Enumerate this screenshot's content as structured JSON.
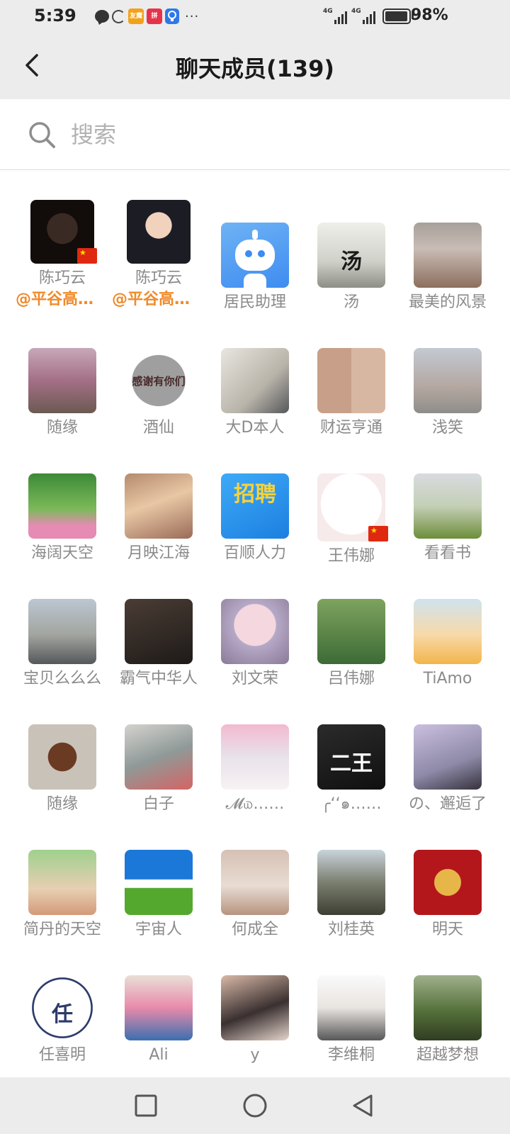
{
  "status_bar": {
    "time": "5:39",
    "app_icon_1": "友魔",
    "app_icon_2": "拼",
    "more": "···",
    "signal_1_label": "4G",
    "signal_2_label": "4G",
    "battery_percent": "98%",
    "battery_level": 0.98
  },
  "header": {
    "title": "聊天成员(139)",
    "back_icon": "chevron-left-icon"
  },
  "search": {
    "placeholder": "搜索",
    "value": ""
  },
  "members": [
    {
      "name": "陈巧云",
      "sub": "@平谷高中附近居民与师生"
    },
    {
      "name": "陈巧云",
      "sub": "@平谷高中附近居民与师生"
    },
    {
      "name": "居民助理"
    },
    {
      "name": "汤",
      "avatar_text": "汤"
    },
    {
      "name": "最美的风景"
    },
    {
      "name": "随缘"
    },
    {
      "name": "酒仙",
      "avatar_text": "感谢有你们"
    },
    {
      "name": "大D本人"
    },
    {
      "name": "财运亨通"
    },
    {
      "name": "浅笑"
    },
    {
      "name": "海阔天空"
    },
    {
      "name": "月映江海"
    },
    {
      "name": "百顺人力",
      "avatar_text": "招聘"
    },
    {
      "name": "王伟娜"
    },
    {
      "name": "看看书"
    },
    {
      "name": "宝贝么么么"
    },
    {
      "name": "霸气中华人"
    },
    {
      "name": "刘文荣"
    },
    {
      "name": "吕伟娜"
    },
    {
      "name": "TiAmo"
    },
    {
      "name": "随缘"
    },
    {
      "name": "白子"
    },
    {
      "name": "𝓜௰……"
    },
    {
      "name": "╭‘‘๑……",
      "avatar_text": "二王"
    },
    {
      "name": "の、邂逅了"
    },
    {
      "name": "简丹的天空"
    },
    {
      "name": "宇宙人"
    },
    {
      "name": "何成全"
    },
    {
      "name": "刘桂英"
    },
    {
      "name": "明天"
    },
    {
      "name": "任喜明",
      "avatar_text": "任"
    },
    {
      "name": "Ali"
    },
    {
      "name": "y"
    },
    {
      "name": "李维桐"
    },
    {
      "name": "超越梦想"
    }
  ],
  "nav_bar": {
    "recent_icon": "square-recent-apps-icon",
    "home_icon": "circle-home-icon",
    "back_icon": "triangle-back-icon"
  },
  "colors": {
    "header_bg": "#ececec",
    "mention_orange": "#f08a2a",
    "name_gray": "#8a8a8a"
  }
}
